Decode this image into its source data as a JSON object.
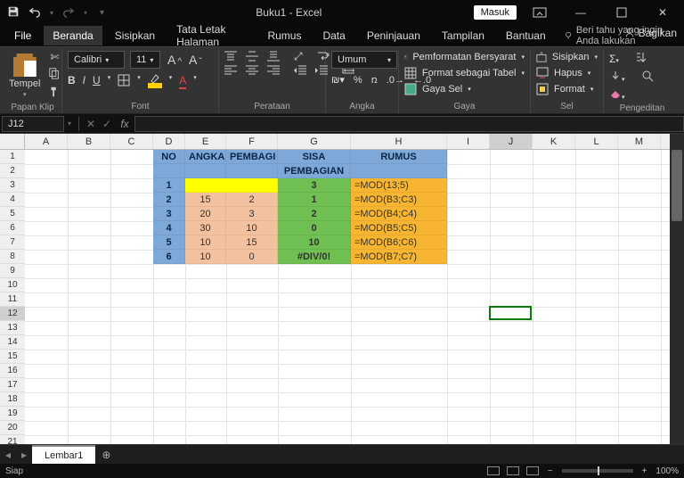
{
  "title": "Buku1 - Excel",
  "signin": "Masuk",
  "tabs": {
    "file": "File",
    "list": [
      "Beranda",
      "Sisipkan",
      "Tata Letak Halaman",
      "Rumus",
      "Data",
      "Peninjauan",
      "Tampilan",
      "Bantuan"
    ],
    "tellme": "Beri tahu yang ingin Anda lakukan",
    "share": "Bagikan"
  },
  "ribbon": {
    "clipboard": {
      "paste": "Tempel",
      "label": "Papan Klip"
    },
    "font": {
      "name": "Calibri",
      "size": "11",
      "label": "Font"
    },
    "alignment": {
      "label": "Perataan"
    },
    "number": {
      "format": "Umum",
      "label": "Angka"
    },
    "styles": {
      "conditional": "Pemformatan Bersyarat",
      "table": "Format sebagai Tabel",
      "cell": "Gaya Sel",
      "label": "Gaya"
    },
    "cells": {
      "insert": "Sisipkan",
      "delete": "Hapus",
      "format": "Format",
      "label": "Sel"
    },
    "editing": {
      "label": "Pengeditan"
    }
  },
  "formula": {
    "namebox": "J12",
    "fxvalue": ""
  },
  "columns": [
    "A",
    "B",
    "C",
    "D",
    "E",
    "F",
    "G",
    "H",
    "I",
    "J",
    "K",
    "L",
    "M"
  ],
  "rowCount": 22,
  "selection": {
    "row": 12,
    "col": "J"
  },
  "table": {
    "headers": {
      "no": "NO",
      "angka": "ANGKA",
      "pembagi": "PEMBAGI",
      "sisa1": "SISA",
      "sisa2": "PEMBAGIAN",
      "rumus": "RUMUS"
    },
    "rows": [
      {
        "no": "1",
        "angka": "",
        "pembagi": "",
        "sisa": "3",
        "rumus": "=MOD(13;5)"
      },
      {
        "no": "2",
        "angka": "15",
        "pembagi": "2",
        "sisa": "1",
        "rumus": "=MOD(B3;C3)"
      },
      {
        "no": "3",
        "angka": "20",
        "pembagi": "3",
        "sisa": "2",
        "rumus": "=MOD(B4;C4)"
      },
      {
        "no": "4",
        "angka": "30",
        "pembagi": "10",
        "sisa": "0",
        "rumus": "=MOD(B5;C5)"
      },
      {
        "no": "5",
        "angka": "10",
        "pembagi": "15",
        "sisa": "10",
        "rumus": "=MOD(B6;C6)"
      },
      {
        "no": "6",
        "angka": "10",
        "pembagi": "0",
        "sisa": "#DIV/0!",
        "rumus": "=MOD(B7;C7)"
      }
    ]
  },
  "sheet_tab": "Lembar1",
  "status": {
    "ready": "Siap",
    "zoom": "100%"
  },
  "colWidths": {
    "A": 48,
    "B": 48,
    "C": 48,
    "D": 36,
    "E": 46,
    "F": 58,
    "G": 82,
    "H": 108,
    "I": 48,
    "J": 48,
    "K": 48,
    "L": 48,
    "M": 48
  }
}
